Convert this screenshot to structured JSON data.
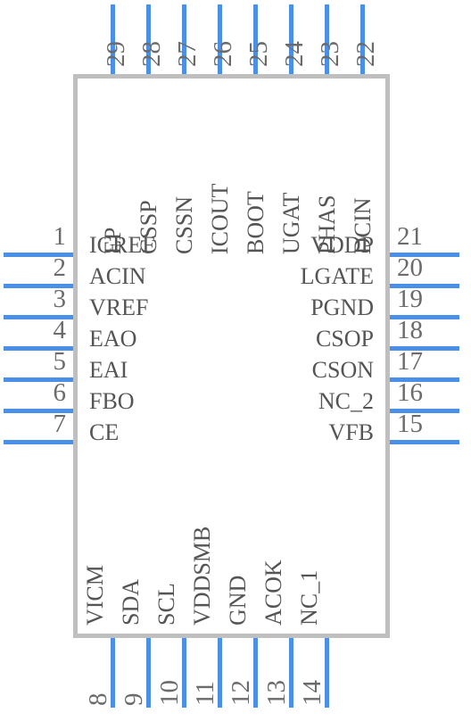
{
  "diagram": {
    "type": "ic-pinout",
    "body": {
      "fill": "#ffffff",
      "stroke": "#bfbfbf"
    },
    "lead_color": "#4a8fe8",
    "number_color": "#6b6b6b",
    "label_color": "#555555"
  },
  "pins": {
    "left": [
      {
        "number": "1",
        "label": "ICREF"
      },
      {
        "number": "2",
        "label": "ACIN"
      },
      {
        "number": "3",
        "label": "VREF"
      },
      {
        "number": "4",
        "label": "EAO"
      },
      {
        "number": "5",
        "label": "EAI"
      },
      {
        "number": "6",
        "label": "FBO"
      },
      {
        "number": "7",
        "label": "CE"
      }
    ],
    "bottom": [
      {
        "number": "8",
        "label": "VICM"
      },
      {
        "number": "9",
        "label": "SDA"
      },
      {
        "number": "10",
        "label": "SCL"
      },
      {
        "number": "11",
        "label": "VDDSMB"
      },
      {
        "number": "12",
        "label": "GND"
      },
      {
        "number": "13",
        "label": "ACOK"
      },
      {
        "number": "14",
        "label": "NC_1"
      }
    ],
    "right": [
      {
        "number": "15",
        "label": "VFB"
      },
      {
        "number": "16",
        "label": "NC_2"
      },
      {
        "number": "17",
        "label": "CSON"
      },
      {
        "number": "18",
        "label": "CSOP"
      },
      {
        "number": "19",
        "label": "PGND"
      },
      {
        "number": "20",
        "label": "LGATE"
      },
      {
        "number": "21",
        "label": "VDDP"
      }
    ],
    "top": [
      {
        "number": "22",
        "label": "DCIN"
      },
      {
        "number": "23",
        "label": "PHAS"
      },
      {
        "number": "24",
        "label": "UGAT"
      },
      {
        "number": "25",
        "label": "BOOT"
      },
      {
        "number": "26",
        "label": "ICOUT"
      },
      {
        "number": "27",
        "label": "CSSN"
      },
      {
        "number": "28",
        "label": "CSSP"
      },
      {
        "number": "29",
        "label": "EP"
      }
    ]
  }
}
